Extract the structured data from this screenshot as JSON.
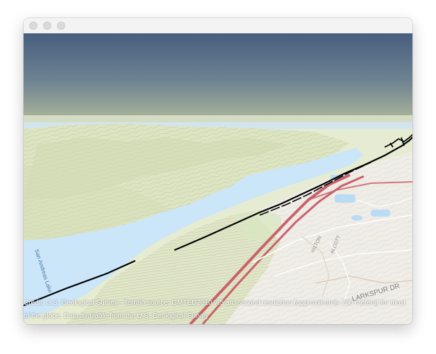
{
  "map": {
    "place_labels": {
      "lake": "San Andreas Lake",
      "street_1": "LARKSPUR DR",
      "street_2": "HILTON",
      "street_3": "ALCOTT"
    },
    "colors": {
      "sky_top": "#475e7e",
      "sky_bottom": "#aab39a",
      "water": "#cbe5f9",
      "terrain": "#dfe7c8",
      "contour": "#c9b79a",
      "highway": "#c9616b",
      "urban": "#eeece7",
      "track": "#000000"
    },
    "credit": "Credit: U.S. Geological Survey - Terrain source: GMTED2010 7.5 arc-second resolution (approximately 250 meters) for most of the globe. Data available from the U.S. Geological Survey"
  }
}
